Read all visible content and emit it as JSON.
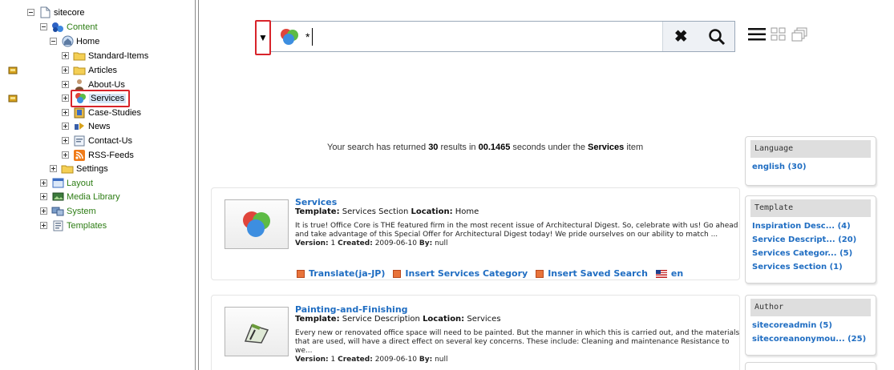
{
  "tree": {
    "root": "sitecore",
    "content": "Content",
    "home": "Home",
    "home_children": [
      "Standard-Items",
      "Articles",
      "About-Us",
      "Services",
      "Case-Studies",
      "News",
      "Contact-Us",
      "RSS-Feeds"
    ],
    "settings": "Settings",
    "layout": "Layout",
    "media_library": "Media Library",
    "system": "System",
    "templates": "Templates"
  },
  "search": {
    "value": "*",
    "dropdown_glyph": "▼",
    "clear_glyph": "✖"
  },
  "summary": {
    "prefix": "Your search has returned",
    "count": "30",
    "mid": "results in",
    "seconds": "00.1465",
    "mid2": "seconds under the",
    "item": "Services",
    "suffix": "item"
  },
  "results": [
    {
      "title": "Services",
      "template_label": "Template:",
      "template": "Services Section",
      "location_label": "Location:",
      "location": "Home",
      "description": "It is true! Office Core is THE featured firm in the most recent issue of Architectural Digest. So, celebrate with us! Go ahead and take advantage of this Special Offer for Architectural Digest today! We pride ourselves on our ability to match ...",
      "version_label": "Version:",
      "version": "1",
      "created_label": "Created:",
      "created": "2009-06-10",
      "by_label": "By:",
      "by": "null",
      "actions": [
        "Translate(ja-JP)",
        "Insert Services Category",
        "Insert Saved Search"
      ],
      "language": "en"
    },
    {
      "title": "Painting-and-Finishing",
      "template_label": "Template:",
      "template": "Service Description",
      "location_label": "Location:",
      "location": "Services",
      "description": "Every new or renovated office space will need to be painted. But the manner in which this is carried out, and the materials that are used, will have a direct effect on several key concerns. These include: Cleaning and maintenance Resistance to we...",
      "version_label": "Version:",
      "version": "1",
      "created_label": "Created:",
      "created": "2009-06-10",
      "by_label": "By:",
      "by": "null"
    }
  ],
  "facets": {
    "language": {
      "title": "Language",
      "items": [
        "english (30)"
      ]
    },
    "template": {
      "title": "Template",
      "items": [
        "Inspiration Desc... (4)",
        "Service Descript... (20)",
        "Services Categor... (5)",
        "Services Section (1)"
      ]
    },
    "author": {
      "title": "Author",
      "items": [
        "sitecoreadmin (5)",
        "sitecoreanonymou... (25)"
      ]
    }
  },
  "colors": {
    "link": "#1f6dc2",
    "highlight": "#d8232a",
    "tree_green": "#2d7d14"
  }
}
